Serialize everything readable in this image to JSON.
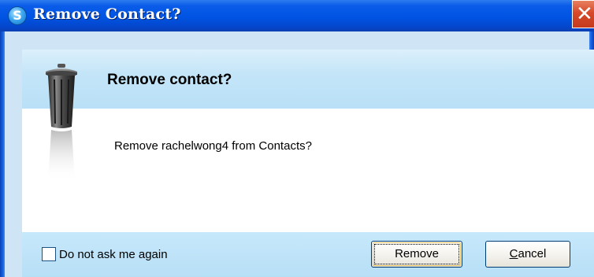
{
  "window": {
    "title": "Remove Contact?",
    "logo_glyph": "S",
    "close_glyph": "✕"
  },
  "dialog": {
    "heading": "Remove contact?",
    "message": "Remove rachelwong4 from Contacts?",
    "icon": "trash-can-icon"
  },
  "footer": {
    "checkbox_label": "Do not ask me again",
    "checkbox_checked": false,
    "remove_label": "Remove",
    "cancel_first_letter": "C",
    "cancel_rest": "ancel"
  },
  "colors": {
    "titlebar": "#0054e3",
    "header_band": "#bfe2f7",
    "content": "#ffffff",
    "close_button": "#d6492a"
  }
}
